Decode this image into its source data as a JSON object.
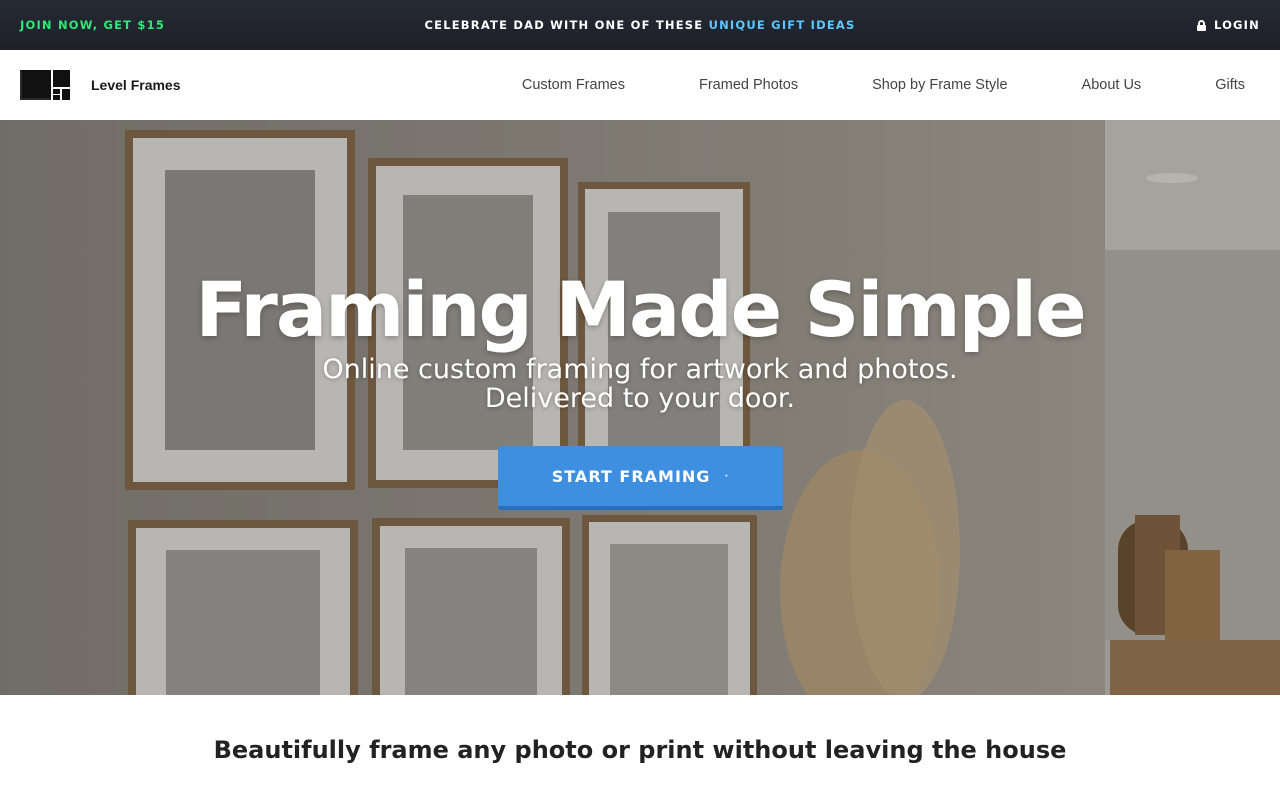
{
  "promo": {
    "left_label": "JOIN NOW, GET $15",
    "center_text": "CELEBRATE DAD WITH ONE OF THESE",
    "center_link": "UNIQUE GIFT IDEAS",
    "login_label": "LOGIN"
  },
  "header": {
    "brand_name": "Level Frames",
    "nav": [
      "Custom Frames",
      "Framed Photos",
      "Shop by Frame Style",
      "About Us",
      "Gifts"
    ]
  },
  "hero": {
    "title": "Framing Made Simple",
    "subtitle_line1": "Online custom framing for artwork and photos.",
    "subtitle_line2": "Delivered to your door.",
    "cta_label": "START FRAMING",
    "cta_icon": "arrow-right-icon"
  },
  "main": {
    "tagline": "Beautifully frame any photo or print without leaving the house"
  },
  "colors": {
    "promo_bg": "#22252c",
    "promo_accent_green": "#2ee87a",
    "promo_link_blue": "#5cc6ff",
    "cta_blue": "#3f8fe0",
    "nav_text": "#444444"
  }
}
